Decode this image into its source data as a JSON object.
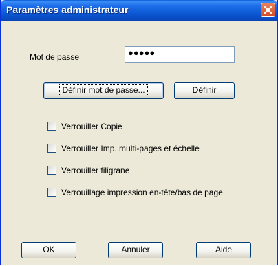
{
  "window": {
    "title": "Paramètres administrateur"
  },
  "password": {
    "label": "Mot de passe",
    "value": "●●●●●"
  },
  "buttons": {
    "set_password": "Définir mot de passe...",
    "set": "Définir",
    "ok": "OK",
    "cancel": "Annuler",
    "help": "Aide"
  },
  "checkboxes": [
    {
      "label": "Verrouiller Copie",
      "checked": false
    },
    {
      "label": "Verrouiller Imp. multi-pages et échelle",
      "checked": false
    },
    {
      "label": "Verrouiller filigrane",
      "checked": false
    },
    {
      "label": "Verrouillage impression en-tête/bas de page",
      "checked": false
    }
  ],
  "icons": {
    "close": "close-icon"
  }
}
